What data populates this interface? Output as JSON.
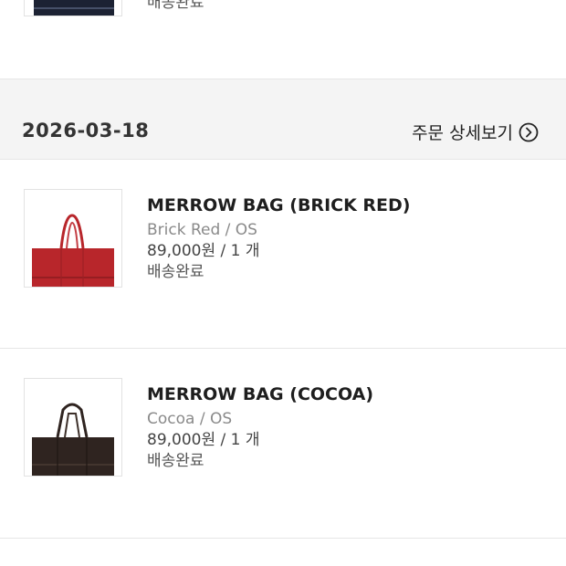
{
  "previous_item": {
    "status": "배송완료",
    "bag_color": "#1c2233"
  },
  "order": {
    "date": "2026-03-18",
    "detail_link_label": "주문 상세보기"
  },
  "items": [
    {
      "name": "MERROW BAG (BRICK RED)",
      "option": "Brick Red / OS",
      "price_qty": "89,000원 / 1 개",
      "status": "배송완료",
      "bag_color": "#b8262b"
    },
    {
      "name": "MERROW BAG (COCOA)",
      "option": "Cocoa / OS",
      "price_qty": "89,000원 / 1 개",
      "status": "배송완료",
      "bag_color": "#2f2420"
    }
  ],
  "icons": {
    "detail_link": "chevron-right-circle-icon"
  }
}
